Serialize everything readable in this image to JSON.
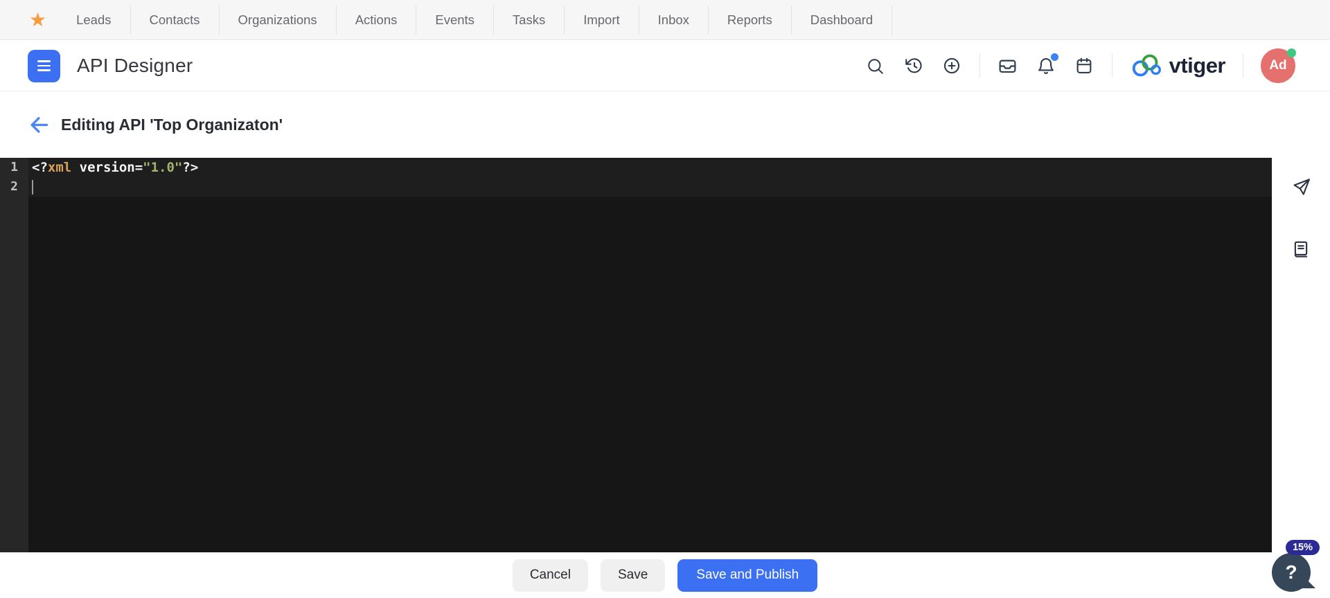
{
  "colors": {
    "accent_blue": "#3c70f2",
    "icon_slate": "#2e3c50",
    "avatar_bg": "#e4716e",
    "presence_green": "#3ec981",
    "notification_dot_blue": "#3b82f6",
    "star_orange": "#f49c3e",
    "badge_indigo": "#2c2a94",
    "bubble_slate": "#36475a",
    "editor_bg": "#161616",
    "gutter_bg": "#272727",
    "token_plain": "#f5f5f5",
    "token_name": "#d6a257",
    "token_string": "#a3b56a"
  },
  "topnav": {
    "items": [
      "Leads",
      "Contacts",
      "Organizations",
      "Actions",
      "Events",
      "Tasks",
      "Import",
      "Inbox",
      "Reports",
      "Dashboard"
    ]
  },
  "header": {
    "title": "API Designer",
    "brand": "vtiger",
    "avatar_initials": "Ad"
  },
  "page": {
    "heading": "Editing API 'Top Organizaton'"
  },
  "editor": {
    "lines": [
      {
        "number": "1",
        "tokens": [
          {
            "text": "<?",
            "type": "plain"
          },
          {
            "text": "xml",
            "type": "name"
          },
          {
            "text": " version=",
            "type": "plain"
          },
          {
            "text": "\"1.0\"",
            "type": "string"
          },
          {
            "text": "?>",
            "type": "plain"
          }
        ]
      },
      {
        "number": "2",
        "tokens": []
      }
    ]
  },
  "footer": {
    "cancel_label": "Cancel",
    "save_label": "Save",
    "save_publish_label": "Save and Publish"
  },
  "help_widget": {
    "badge": "15%",
    "question_mark": "?"
  }
}
